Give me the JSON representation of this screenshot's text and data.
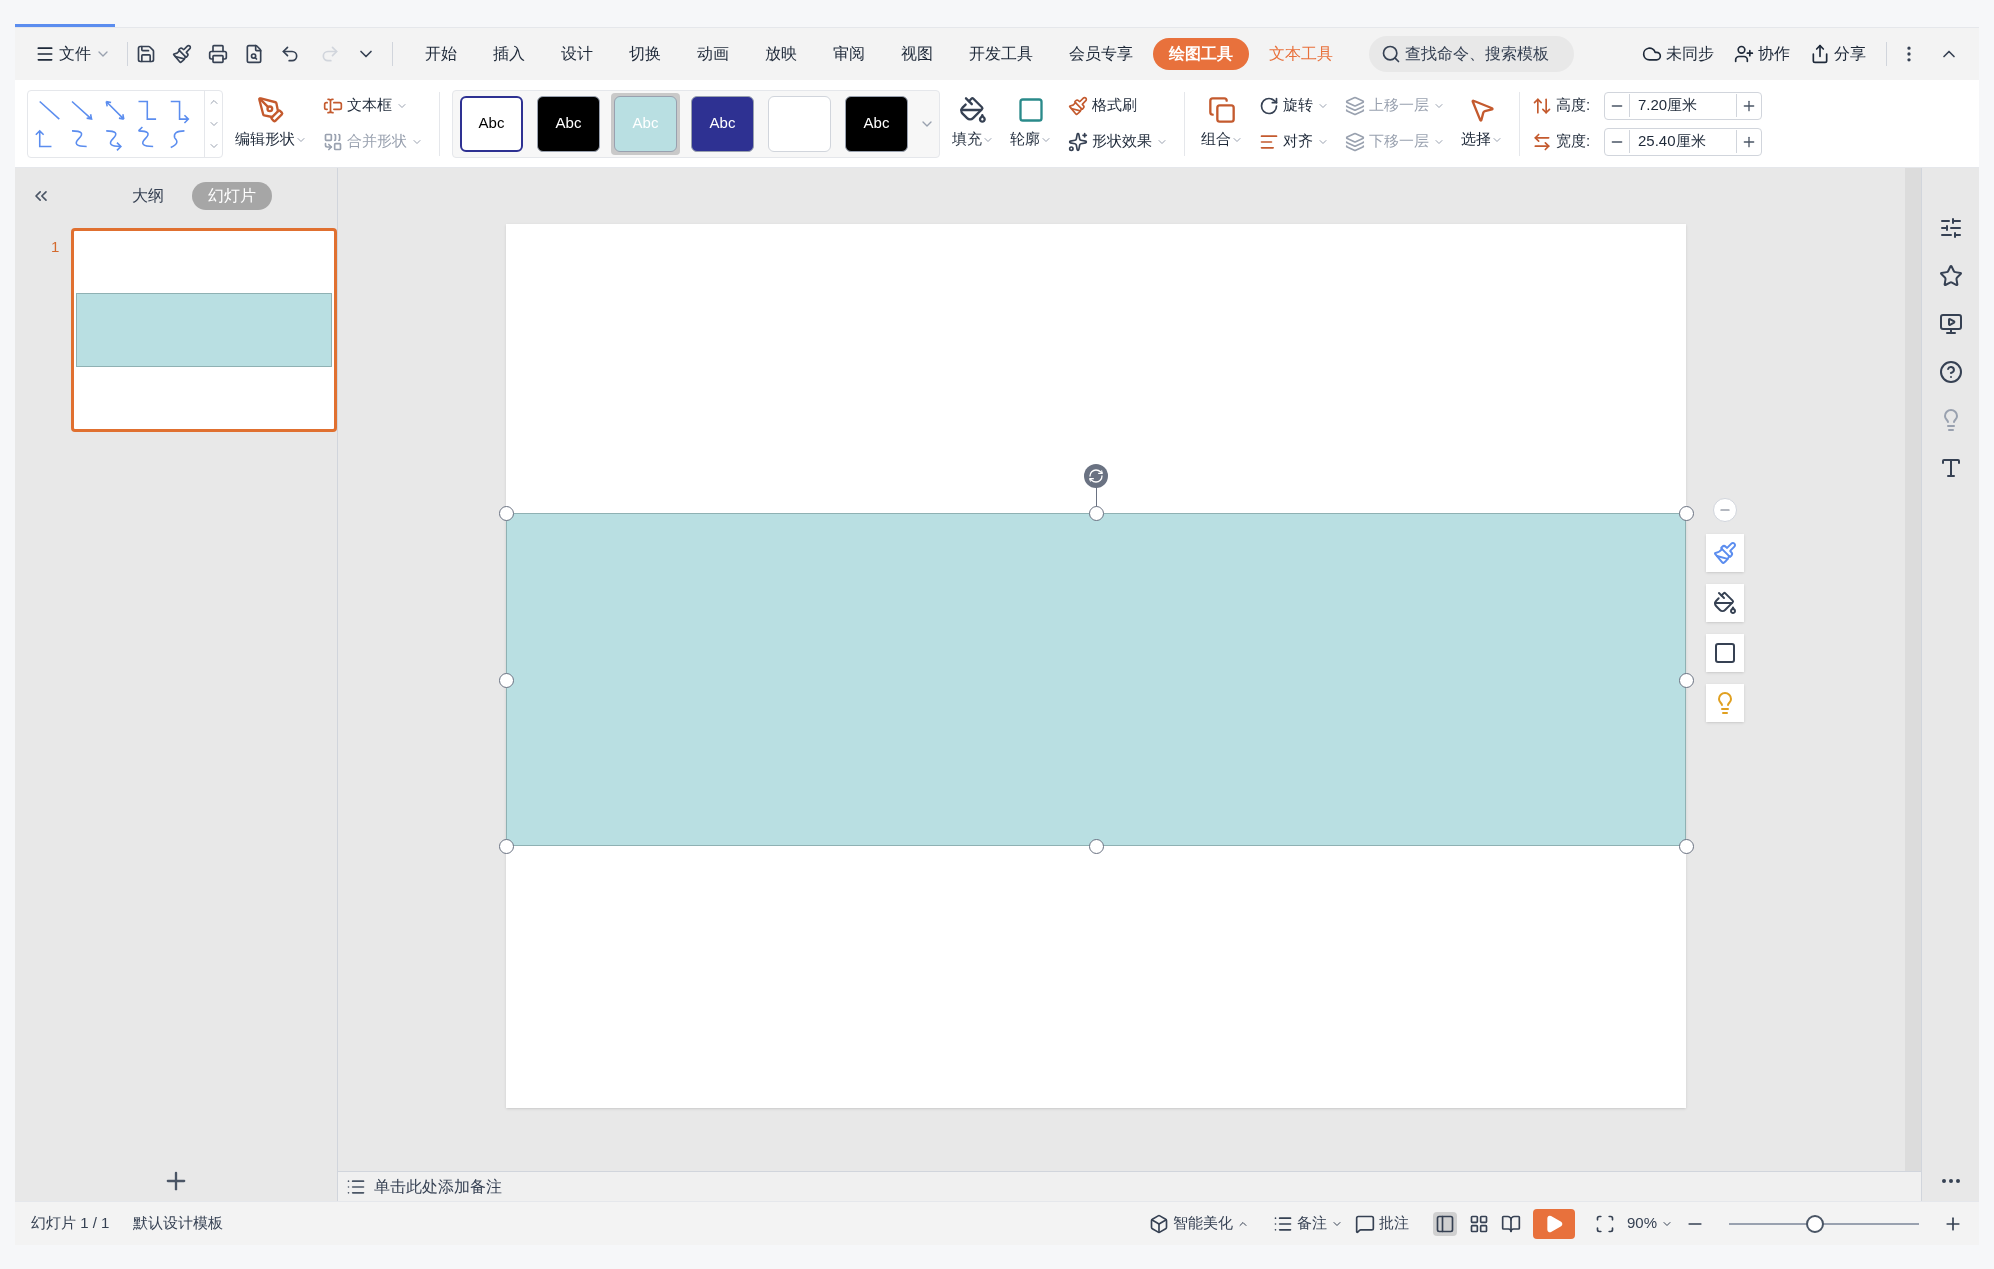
{
  "menu_bar": {
    "file": "文件",
    "tabs": [
      {
        "label": "开始",
        "kind": "tab",
        "selected": false
      },
      {
        "label": "插入",
        "kind": "tab",
        "selected": false
      },
      {
        "label": "设计",
        "kind": "tab",
        "selected": false
      },
      {
        "label": "切换",
        "kind": "tab",
        "selected": false
      },
      {
        "label": "动画",
        "kind": "tab",
        "selected": false
      },
      {
        "label": "放映",
        "kind": "tab",
        "selected": false
      },
      {
        "label": "审阅",
        "kind": "tab",
        "selected": false
      },
      {
        "label": "视图",
        "kind": "tab",
        "selected": false
      },
      {
        "label": "开发工具",
        "kind": "tab",
        "selected": false
      },
      {
        "label": "会员专享",
        "kind": "tab",
        "selected": false
      },
      {
        "label": "绘图工具",
        "kind": "contextual",
        "selected": true
      },
      {
        "label": "文本工具",
        "kind": "contextual",
        "selected": false
      }
    ],
    "search": {
      "placeholder": "查找命令、搜索模板"
    },
    "actions": [
      "未同步",
      "协作",
      "分享"
    ]
  },
  "ribbon": {
    "edit_shape": "编辑形状",
    "text_box": "文本框",
    "merge_shape": {
      "label": "合并形状",
      "disabled": true
    },
    "styles": [
      {
        "label": "Abc",
        "color": "#ffffff",
        "selected": false
      },
      {
        "label": "Abc",
        "color": "#000000",
        "selected": false
      },
      {
        "label": "Abc",
        "color": "#b9dfe2",
        "selected": true
      },
      {
        "label": "Abc",
        "color": "#2e3192",
        "selected": false
      },
      {
        "color": "#ffffff",
        "selected": false
      },
      {
        "label": "Abc",
        "color": "#000000",
        "selected": false
      }
    ],
    "fill": "填充",
    "outline": "轮廓",
    "format_painter": "格式刷",
    "shape_effects": "形状效果",
    "group": "组合",
    "rotate": "旋转",
    "align": "对齐",
    "bring_forward": {
      "label": "上移一层",
      "disabled": true
    },
    "send_backward": {
      "label": "下移一层",
      "disabled": true
    },
    "select": "选择",
    "height": {
      "label": "高度:",
      "value": "7.20厘米"
    },
    "width": {
      "label": "宽度:",
      "value": "25.40厘米"
    }
  },
  "left_panel": {
    "tabs": [
      {
        "label": "大纲",
        "selected": false
      },
      {
        "label": "幻灯片",
        "selected": true
      }
    ],
    "slides": [
      {
        "number": "1",
        "selected": true
      }
    ]
  },
  "notes": {
    "prompt": "单击此处添加备注"
  },
  "status_bar": {
    "slide": "幻灯片 1 / 1",
    "template": "默认设计模板",
    "beautify": "智能美化",
    "notes": "备注",
    "comments": "批注",
    "zoom": "90%",
    "zoom_slider": {
      "level": 0.45
    }
  }
}
